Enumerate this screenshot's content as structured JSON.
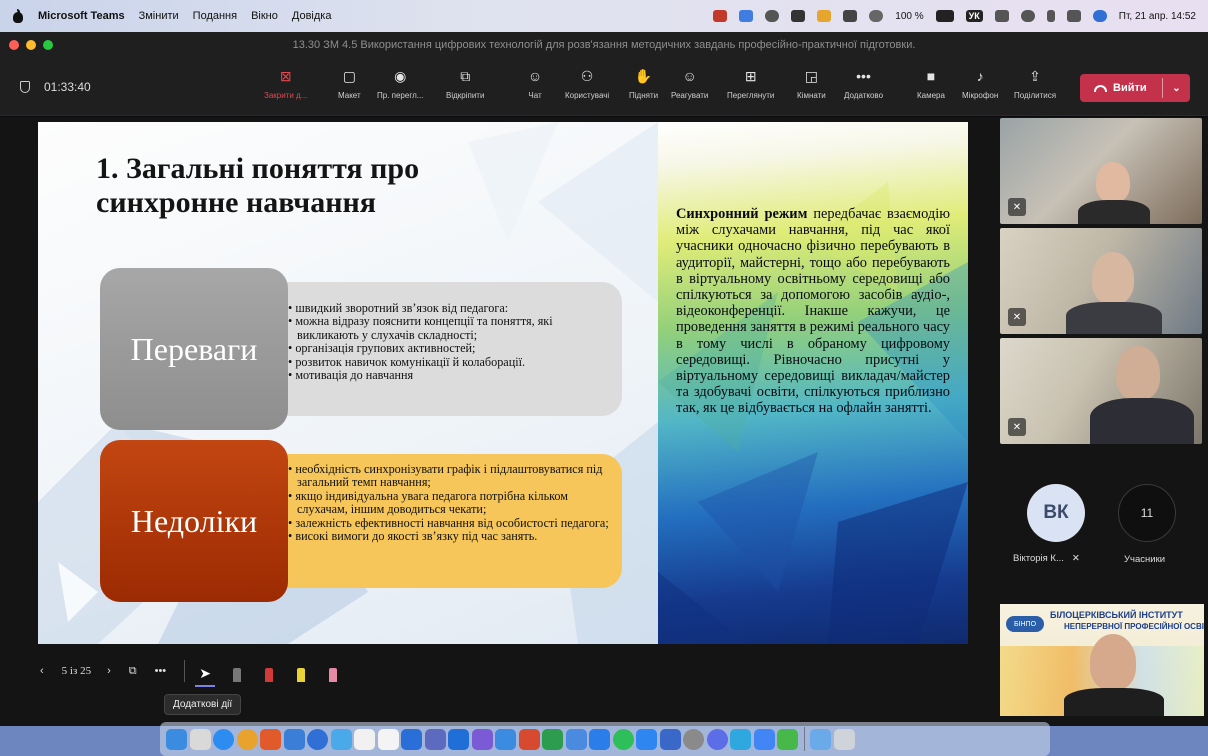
{
  "menubar": {
    "app_name": "Microsoft Teams",
    "menu_items": [
      "Змінити",
      "Подання",
      "Вікно",
      "Довідка"
    ],
    "battery": "100 %",
    "keyboard_layout": "УК",
    "datetime": "Пт, 21 апр.  14:52"
  },
  "window": {
    "title": "13.30 ЗМ 4.5 Використання цифрових технологій для розв'язання методичних завдань професійно-практичної підготовки."
  },
  "toolbar": {
    "timer": "01:33:40",
    "buttons": [
      {
        "label": "Закрити д...",
        "icon": "close-share-icon"
      },
      {
        "label": "Макет",
        "icon": "layout-icon"
      },
      {
        "label": "Пр. перегл...",
        "icon": "eye-icon"
      },
      {
        "label": "Відкріпити",
        "icon": "popout-icon"
      },
      {
        "label": "Чат",
        "icon": "chat-icon"
      },
      {
        "label": "Користувачі",
        "icon": "people-icon"
      },
      {
        "label": "Підняти",
        "icon": "raise-hand-icon"
      },
      {
        "label": "Реагувати",
        "icon": "smiley-icon"
      },
      {
        "label": "Переглянути",
        "icon": "view-icon"
      },
      {
        "label": "Кімнати",
        "icon": "rooms-icon"
      },
      {
        "label": "Додатково",
        "icon": "more-icon"
      },
      {
        "label": "Камера",
        "icon": "camera-icon"
      },
      {
        "label": "Мікрофон",
        "icon": "mic-icon"
      },
      {
        "label": "Поділитися",
        "icon": "share-icon"
      }
    ],
    "leave_label": "Вийти"
  },
  "slide": {
    "title_line1": "1. Загальні поняття про",
    "title_line2": "синхронне навчання",
    "advantages_label": "Переваги",
    "advantages": [
      "швидкий зворотний зв’язок від педагога:",
      "можна відразу пояснити концепції та поняття, які викликають у слухачів складності;",
      "організація групових активностей;",
      "розвиток навичок комунікації й колаборації.",
      "мотивація до навчання"
    ],
    "disadvantages_label": "Недоліки",
    "disadvantages": [
      "необхідність синхронізувати графік і підлаштовуватися під загальний темп навчання;",
      "якщо індивідуальна увага педагога потрібна кільком слухачам, іншим доводиться чекати;",
      "залежність ефективності навчання від особистості педагога;",
      "високі вимоги до якості зв’язку під час занять."
    ],
    "right_bold": "Синхронний режим",
    "right_text": " передбачає взаємодію між слухачами навчання, під час якої учасники одночасно фізично перебувають в аудиторії, майстерні, тощо або перебувають в віртуальному освітньому середовищі або спілкуються за допомогою засобів аудіо-, відеоконференції. Інакше кажучи, це проведення заняття в режимі реального часу в тому числі в обраному цифровому середовищі. Рівночасно присутні у віртуальному середовищі викладач/майстер та здобувачі освіти, спілкуються приблизно так, як це відбувається на офлайн занятті."
  },
  "presenter": {
    "page": "5 із 25",
    "tooltip": "Додаткові дії"
  },
  "participants": {
    "vk_initials": "ВК",
    "vk_name": "Вікторія К...",
    "count": "11",
    "count_label": "Учасники",
    "banner_line1": "БІЛОЦЕРКІВСЬКИЙ ІНСТИТУТ",
    "banner_line2": "НЕПЕРЕРВНОЇ ПРОФЕСІЙНОЇ ОСВІТИ",
    "banner_logo": "БІНПО"
  },
  "colors": {
    "accent": "#7b83eb",
    "leave": "#c4314b",
    "close_share": "#e3474f",
    "adv_box": "#9a9a9a",
    "dis_box": "#b3390a",
    "dis_list": "#f6c65a"
  }
}
